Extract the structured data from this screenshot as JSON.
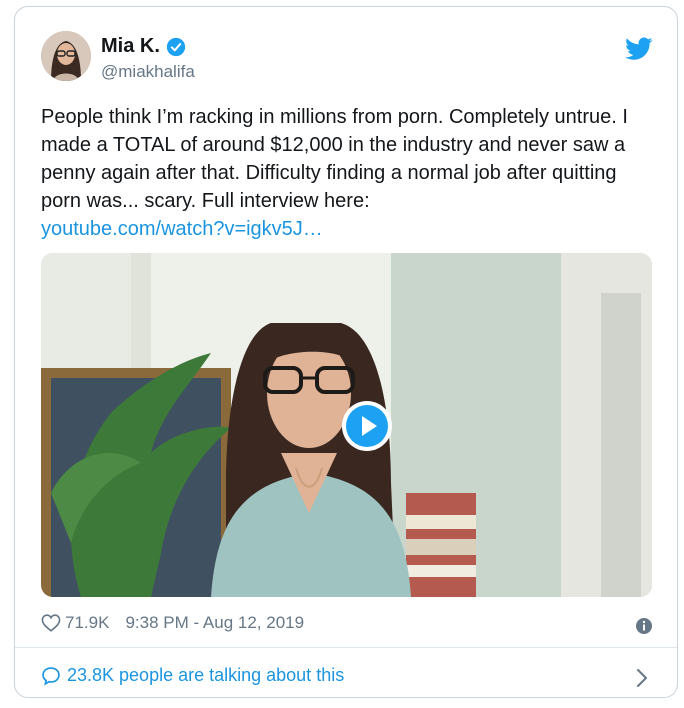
{
  "author": {
    "name": "Mia K.",
    "handle": "@miakhalifa",
    "verified_icon": "verified-badge-icon",
    "avatar_icon": "avatar"
  },
  "brand_icon": "twitter-bird-icon",
  "tweet": {
    "text": "People think I’m racking in millions from porn. Completely untrue. I made a TOTAL of around $12,000 in the industry and never saw a penny again after that. Difficulty finding a normal job after quitting porn was... scary. Full interview here:",
    "link": "youtube.com/watch?v=igkv5J…"
  },
  "media": {
    "play_icon": "play-icon"
  },
  "stats": {
    "likes": "71.9K",
    "timestamp": "9:38 PM - Aug 12, 2019"
  },
  "footer": {
    "talking": "23.8K people are talking about this"
  },
  "colors": {
    "accent": "#1b95e0",
    "text": "#14171a",
    "muted": "#657786",
    "border": "#c9d4dc"
  }
}
